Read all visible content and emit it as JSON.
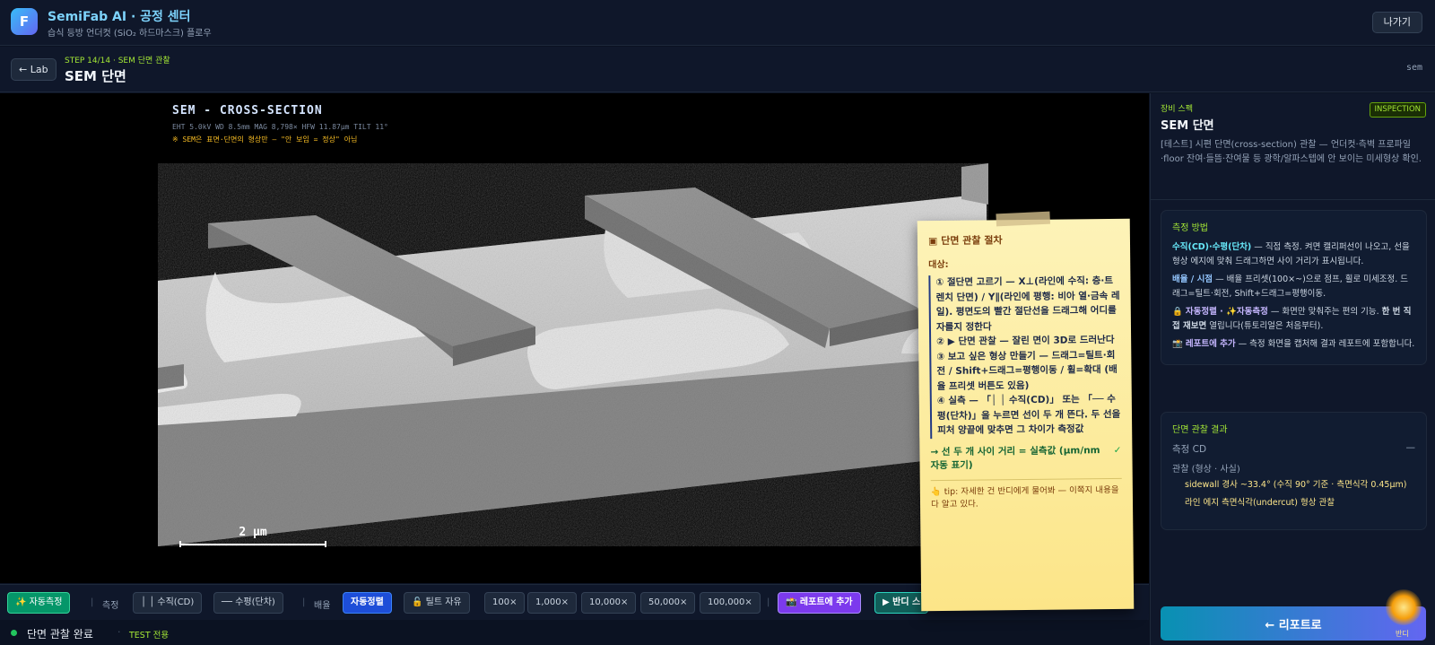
{
  "app": {
    "logo": "F",
    "title": "SemiFab AI · 공정 센터",
    "subtitle": "습식 등방 언더컷 (SiO₂ 하드마스크) 플로우",
    "exit_label": "나가기"
  },
  "step": {
    "back_label": "← Lab",
    "label": "STEP 14/14 · SEM 단면 관찰",
    "title": "SEM 단면",
    "code": "sem"
  },
  "sem": {
    "title": "SEM - CROSS-SECTION",
    "params": "EHT 5.0kV  WD 8.5mm  MAG 8,798×  HFW 11.87μm  TILT 11°",
    "warning": "※ SEM은 표면·단면의 형상만 — \"안 보임 = 정상\" 아님",
    "scale_label": "2 μm"
  },
  "note": {
    "title": "▣ 단면 관찰 절차",
    "target_label": "대상:",
    "steps": [
      "① 절단면 고르기 — X⊥(라인에 수직: 층·트렌치 단면) / Y∥(라인에 평행: 비아 열·금속 레일). 평면도의 빨간 절단선을 드래그해 어디를 자를지 정한다",
      "② ▶ 단면 관찰 — 잘린 면이 3D로 드러난다",
      "③ 보고 싶은 형상 만들기 — 드래그=틸트·회전 / Shift+드래그=평행이동 / 휠=확대 (배율 프리셋 버튼도 있음)",
      "④ 실측 — 「│ │ 수직(CD)」 또는 「── 수평(단차)」을 누르면 선이 두 개 뜬다. 두 선을 피처 양끝에 맞추면 그 차이가 측정값"
    ],
    "result": "→ 선 두 개 사이 거리 = 실측값 (μm/nm 자동 표기)",
    "check": "✓",
    "tip": "👆 tip: 자세한 건 반디에게 물어봐 — 이쪽지 내용을 다 알고 있다."
  },
  "toolbar": {
    "auto_measure": "✨ 자동측정",
    "measure_label": "측정",
    "vertical": "│ │ 수직(CD)",
    "horizontal": "── 수평(단차)",
    "mag_label": "배율",
    "auto_align": "자동정렬",
    "tilt_free": "🔓 틸트 자유",
    "mags": [
      "100×",
      "1,000×",
      "10,000×",
      "50,000×",
      "100,000×"
    ],
    "add_report": "📸 레포트에 추가",
    "ask_bandi": "▶ 반디 스"
  },
  "status": {
    "text": "단면 관찰 완료",
    "sep": "·",
    "tag": "TEST 전용"
  },
  "panel": {
    "eq_label": "장비 스펙",
    "eq_title": "SEM 단면",
    "badge": "INSPECTION",
    "desc": "[테스트] 시편 단면(cross-section) 관찰 — 언더컷·측벽 프로파일·floor 잔여·들뜸·잔여물 등 광학/알파스텝에 안 보이는 미세형상 확인.",
    "method_title": "측정 방법",
    "m1_key": "수직(CD)·수평(단차)",
    "m1_text": " — 직접 측정. 켜면 캘리퍼선이 나오고, 선을 형상 에지에 맞춰 드래그하면 사이 거리가 표시됩니다.",
    "m2_key": "배율 / 시점",
    "m2_text": " — 배율 프리셋(100×~)으로 점프, 휠로 미세조정. 드래그=틸트·회전, Shift+드래그=평행이동.",
    "m3_prefix": "🔒 ",
    "m3_key": "자동정렬 · ✨자동측정",
    "m3_text": " — 화면만 맞춰주는 편의 기능. ",
    "m3_bold": "한 번 직접 재보면",
    "m3_rest": " 열립니다(튜토리얼은 처음부터).",
    "m4_prefix": "📸 ",
    "m4_key": "레포트에 추가",
    "m4_text": " — 측정 화면을 캡처해 결과 레포트에 포함합니다.",
    "result_title": "단면 관찰 결과",
    "cd_label": "측정 CD",
    "cd_value": "—",
    "obs_label": "관찰 (형상 · 사실)",
    "obs_items": [
      "sidewall 경사 ~33.4° (수직 90° 기준 · 측면식각 0.45μm)",
      "라인 에지 측면식각(undercut) 형상 관찰"
    ],
    "report_btn": "← 리포트로",
    "bandi_label": "반디"
  }
}
